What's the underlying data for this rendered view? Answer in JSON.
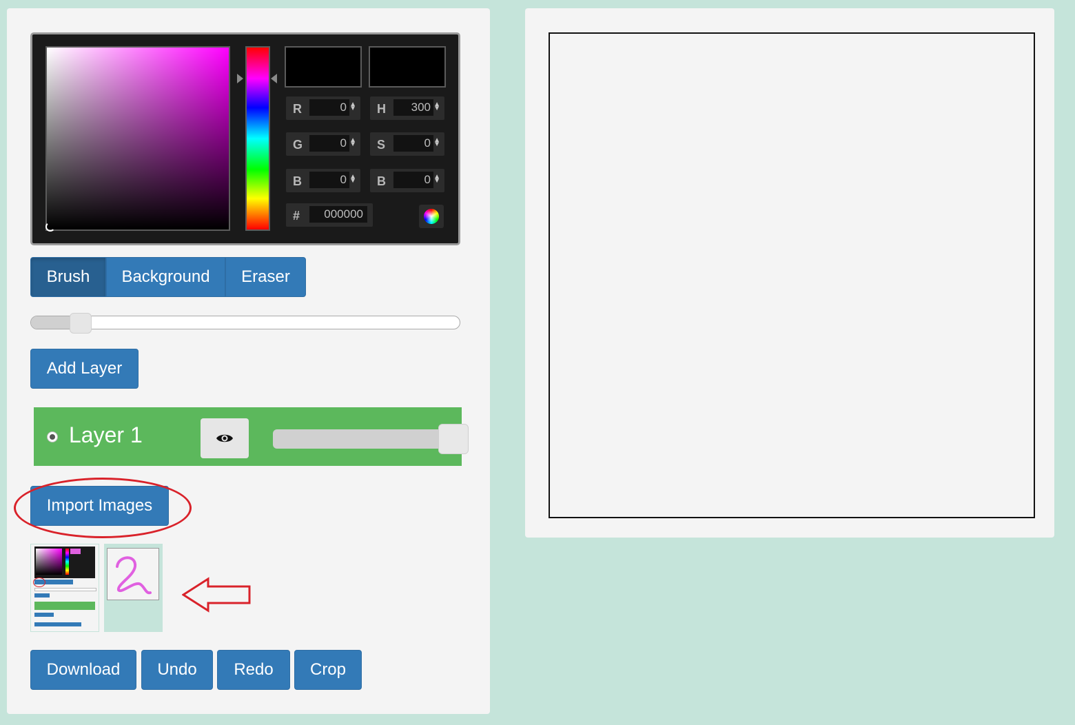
{
  "colors": {
    "page_background": "#c5e4da",
    "panel_background": "#f4f4f4",
    "primary_button": "#337ab7",
    "primary_button_active": "#286090",
    "layer_active": "#5cb85c",
    "annotation_red": "#d9222a",
    "picker_background": "#1a1a1a"
  },
  "color_picker": {
    "selected_color": "#000000",
    "fields": {
      "r": {
        "label": "R",
        "value": "0"
      },
      "g": {
        "label": "G",
        "value": "0"
      },
      "b": {
        "label": "B",
        "value": "0"
      },
      "h": {
        "label": "H",
        "value": "300"
      },
      "s": {
        "label": "S",
        "value": "0"
      },
      "v": {
        "label": "B",
        "value": "0"
      }
    },
    "hex": {
      "label": "#",
      "value": "000000"
    }
  },
  "tools": {
    "brush": "Brush",
    "background": "Background",
    "eraser": "Eraser",
    "active": "brush"
  },
  "brush_size": {
    "fraction": 0.09
  },
  "add_layer_label": "Add Layer",
  "layers": [
    {
      "name": "Layer 1",
      "selected": true,
      "visible": true,
      "opacity_fraction": 1.0
    }
  ],
  "import_images_label": "Import Images",
  "thumbnails": [
    {
      "name": "screenshot-thumbnail"
    },
    {
      "name": "squiggle-thumbnail",
      "stroke_color": "#e060e0"
    }
  ],
  "bottom_buttons": {
    "download": "Download",
    "undo": "Undo",
    "redo": "Redo",
    "crop": "Crop"
  }
}
